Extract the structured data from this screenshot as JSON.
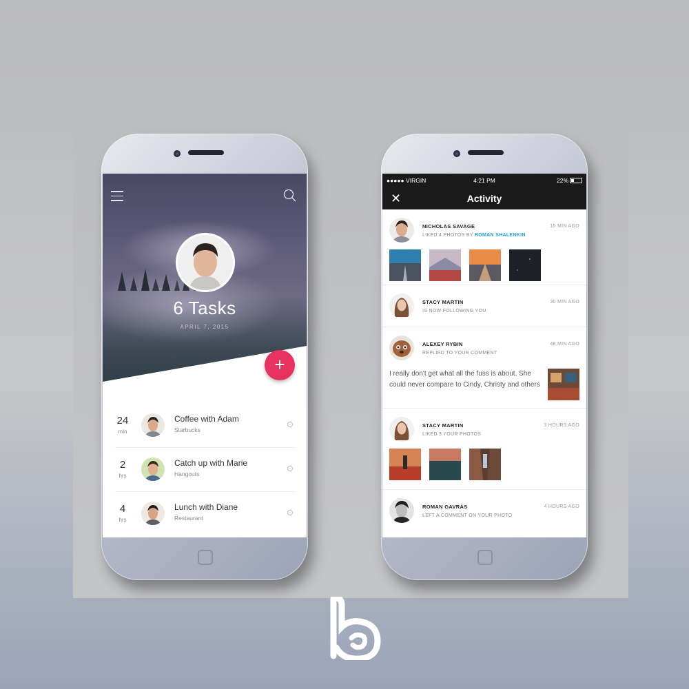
{
  "left_app": {
    "tasks_title": "6 Tasks",
    "date": "APRIL 7, 2015",
    "fab_label": "+",
    "accent_color": "#e8325f",
    "tasks": [
      {
        "num": "24",
        "unit": "min",
        "title": "Coffee with Adam",
        "place": "Starbucks"
      },
      {
        "num": "2",
        "unit": "hrs",
        "title": "Catch up with Marie",
        "place": "Hangouts"
      },
      {
        "num": "4",
        "unit": "hrs",
        "title": "Lunch with Diane",
        "place": "Restaurant"
      }
    ]
  },
  "right_app": {
    "status": {
      "carrier": "●●●●● VIRGIN",
      "time": "4:21 PM",
      "battery": "22%"
    },
    "title": "Activity",
    "close_icon": "close-icon",
    "feed": [
      {
        "name": "NICHOLAS SAVAGE",
        "action": "LIKED 4 PHOTOS BY",
        "action_link": "ROMAN SHALENKIN",
        "time": "15 MIN AGO"
      },
      {
        "name": "STACY MARTIN",
        "action": "IS NOW FOLLOWING YOU",
        "time": "30 MIN AGO"
      },
      {
        "name": "ALEXEY RYBIN",
        "action": "REPLIED TO YOUR COMMENT",
        "time": "48 MIN AGO",
        "comment": "I really don't get what all the fuss is about. She could never compare to Cindy, Christy and others"
      },
      {
        "name": "STACY MARTIN",
        "action": "LIKED 3 YOUR PHOTOS",
        "time": "3 HOURS AGO"
      },
      {
        "name": "ROMAN GAVRÀS",
        "action": "LEFT A COMMENT ON YOUR PHOTO",
        "time": "4 HOURS AGO"
      }
    ],
    "link_color": "#1ea0d9"
  },
  "brand_logo": "b-logo-icon"
}
